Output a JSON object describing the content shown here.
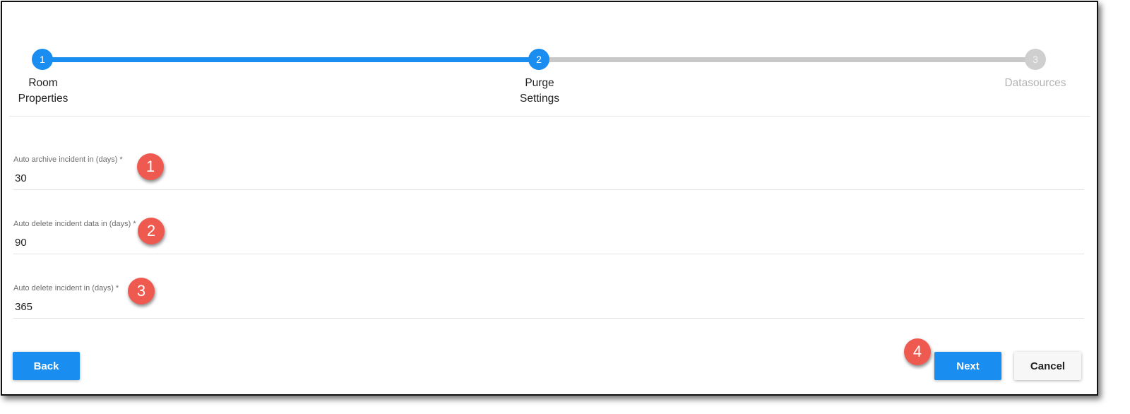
{
  "stepper": {
    "steps": [
      {
        "number": "1",
        "label_line1": "Room",
        "label_line2": "Properties"
      },
      {
        "number": "2",
        "label_line1": "Purge",
        "label_line2": "Settings"
      },
      {
        "number": "3",
        "label_line1": "Datasources",
        "label_line2": ""
      }
    ],
    "colors": {
      "active": "#1a8ef0",
      "inactive": "#c9c9c9"
    }
  },
  "fields": [
    {
      "label": "Auto archive incident in (days) *",
      "value": "30",
      "callout": "1"
    },
    {
      "label": "Auto delete incident data in (days) *",
      "value": "90",
      "callout": "2"
    },
    {
      "label": "Auto delete incident in (days) *",
      "value": "365",
      "callout": "3"
    }
  ],
  "buttons": {
    "back": "Back",
    "next": "Next",
    "cancel": "Cancel",
    "next_callout": "4"
  },
  "colors": {
    "primary": "#1a8ef0",
    "callout": "#ef5a50"
  }
}
